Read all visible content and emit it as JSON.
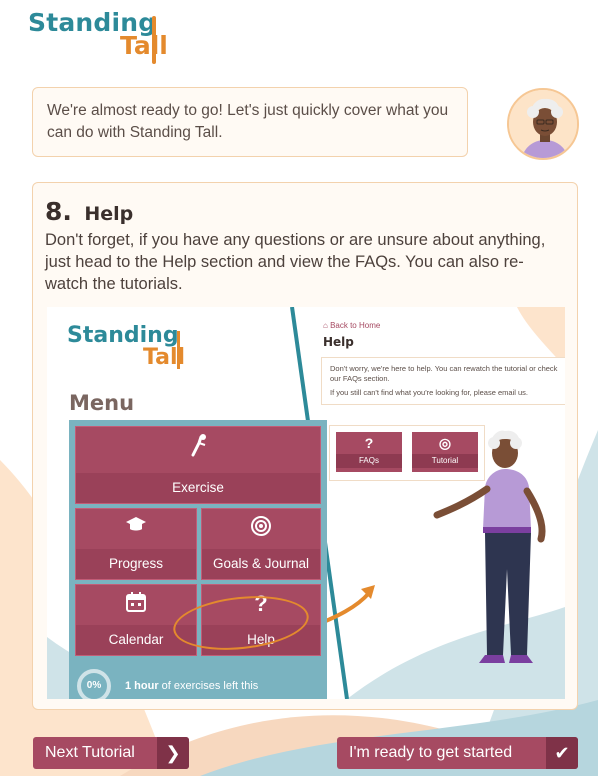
{
  "logo": {
    "line1": "Standing",
    "line2": "Tall"
  },
  "intro": {
    "text": "We're almost ready to go! Let's just quickly cover what you can do with Standing Tall."
  },
  "step": {
    "number": "8.",
    "title": "Help",
    "description": "Don't forget, if you have any questions or are unsure about anything, just head to the Help section and view the FAQs. You can also re-watch the tutorials."
  },
  "preview": {
    "logo": {
      "line1": "Standing",
      "line2": "Tall"
    },
    "menu_title": "Menu",
    "tiles": {
      "exercise": "Exercise",
      "progress": "Progress",
      "goals": "Goals & Journal",
      "calendar": "Calendar",
      "help": "Help",
      "help_icon": "?"
    },
    "progress_pct": "0%",
    "progress_bold": "1 hour",
    "progress_rest": " of exercises left this",
    "back_link": "Back to Home",
    "help_title": "Help",
    "help_text_1": "Don't worry, we're here to help. You can rewatch the tutorial or check our FAQs section.",
    "help_text_2": "If you still can't find what you're looking for, please email us.",
    "faq_icon": "?",
    "faq_label": "FAQs",
    "tutorial_icon": "◎",
    "tutorial_label": "Tutorial"
  },
  "buttons": {
    "next": "Next Tutorial",
    "next_icon": "❯",
    "start": "I'm ready to get started",
    "start_icon": "✔"
  },
  "colors": {
    "teal": "#2d8a99",
    "orange": "#e48a2d",
    "maroon": "#a64a62",
    "card_border": "#f3d2ad"
  }
}
